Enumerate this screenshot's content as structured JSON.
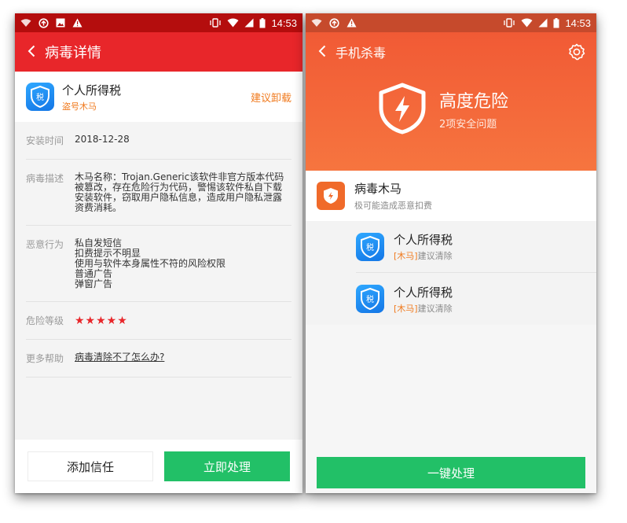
{
  "left": {
    "status_bar": {
      "time": "14:53"
    },
    "app_bar": {
      "title": "病毒详情"
    },
    "app": {
      "name": "个人所得税",
      "type": "盗号木马",
      "action": "建议卸载",
      "icon_text": "税"
    },
    "details": [
      {
        "label": "安装时间",
        "lines": [
          "2018-12-28"
        ]
      },
      {
        "label": "病毒描述",
        "lines": [
          "木马名称：Trojan.Generic该软件非官方版本代码",
          "被篡改，存在危险行为代码，警惕该软件私自下载",
          "安装软件，窃取用户隐私信息，造成用户隐私泄露",
          "资费消耗。"
        ]
      },
      {
        "label": "恶意行为",
        "lines": [
          "私自发短信",
          "扣费提示不明显",
          "使用与软件本身属性不符的风险权限",
          "普通广告",
          "弹窗广告"
        ]
      }
    ],
    "risk": {
      "label": "危险等级",
      "stars": "★★★★★"
    },
    "help": {
      "label": "更多帮助",
      "link": "病毒清除不了怎么办?"
    },
    "buttons": {
      "trust": "添加信任",
      "handle": "立即处理"
    }
  },
  "right": {
    "status_bar": {
      "time": "14:53"
    },
    "header": {
      "title": "手机杀毒"
    },
    "hero": {
      "level": "高度危险",
      "summary": "2项安全问题"
    },
    "category": {
      "name": "病毒木马",
      "desc": "极可能造成恶意扣费"
    },
    "items": [
      {
        "name": "个人所得税",
        "tag": "[木马]",
        "suggestion": "建议清除",
        "icon_text": "税"
      },
      {
        "name": "个人所得税",
        "tag": "[木马]",
        "suggestion": "建议清除",
        "icon_text": "税"
      }
    ],
    "button": {
      "label": "一键处理"
    }
  },
  "colors": {
    "left_header": "#e8262a",
    "right_header": "#f15a35",
    "primary_green": "#22c067",
    "warning_orange": "#f07a1e"
  }
}
